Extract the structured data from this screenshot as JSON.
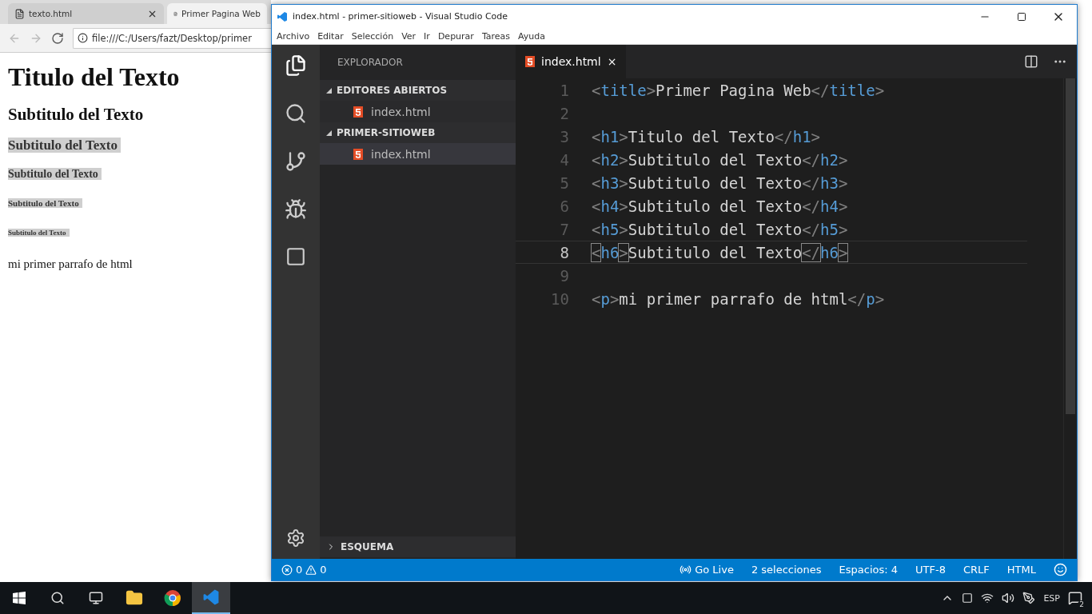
{
  "browser": {
    "tabs": [
      {
        "title": "texto.html",
        "selected": false
      },
      {
        "title": "Primer Pagina Web",
        "selected": true
      }
    ],
    "address": "file:///C:/Users/fazt/Desktop/primer",
    "headings": [
      {
        "kind": "h1",
        "text": "Titulo del Texto",
        "highlighted": false
      },
      {
        "kind": "h2",
        "text": "Subtitulo del Texto",
        "highlighted": false
      },
      {
        "kind": "h3",
        "text": "Subtitulo del Texto",
        "highlighted": true
      },
      {
        "kind": "h4",
        "text": "Subtitulo del Texto",
        "highlighted": true
      },
      {
        "kind": "h5",
        "text": "Subtitulo del Texto",
        "highlighted": true
      },
      {
        "kind": "h6",
        "text": "Subtitulo del Texto",
        "highlighted": true
      }
    ],
    "paragraph": "mi primer parrafo de html"
  },
  "vscode": {
    "title": "index.html - primer-sitioweb - Visual Studio Code",
    "menu": [
      "Archivo",
      "Editar",
      "Selección",
      "Ver",
      "Ir",
      "Depurar",
      "Tareas",
      "Ayuda"
    ],
    "explorer_title": "EXPLORADOR",
    "sections": [
      {
        "title": "EDITORES ABIERTOS",
        "expanded": true,
        "files": [
          {
            "name": "index.html",
            "selected": false
          }
        ]
      },
      {
        "title": "PRIMER-SITIOWEB",
        "expanded": true,
        "files": [
          {
            "name": "index.html",
            "selected": true
          }
        ]
      }
    ],
    "outline": {
      "title": "ESQUEMA",
      "expanded": false
    },
    "tab": {
      "label": "index.html",
      "close": "×"
    },
    "lines": [
      {
        "number": "1",
        "current": false,
        "segments": [
          {
            "kind": "punct",
            "text": "<",
            "matched": false
          },
          {
            "kind": "tag",
            "text": "title",
            "matched": false
          },
          {
            "kind": "punct",
            "text": ">",
            "matched": false
          },
          {
            "kind": "text",
            "text": "Primer Pagina Web",
            "matched": false
          },
          {
            "kind": "punct",
            "text": "</",
            "matched": false
          },
          {
            "kind": "tag",
            "text": "title",
            "matched": false
          },
          {
            "kind": "punct",
            "text": ">",
            "matched": false
          }
        ]
      },
      {
        "number": "2",
        "current": false
      },
      {
        "number": "3",
        "current": false,
        "segments": [
          {
            "kind": "punct",
            "text": "<",
            "matched": false
          },
          {
            "kind": "tag",
            "text": "h1",
            "matched": false
          },
          {
            "kind": "punct",
            "text": ">",
            "matched": false
          },
          {
            "kind": "text",
            "text": "Titulo del Texto",
            "matched": false
          },
          {
            "kind": "punct",
            "text": "</",
            "matched": false
          },
          {
            "kind": "tag",
            "text": "h1",
            "matched": false
          },
          {
            "kind": "punct",
            "text": ">",
            "matched": false
          }
        ]
      },
      {
        "number": "4",
        "current": false,
        "segments": [
          {
            "kind": "punct",
            "text": "<",
            "matched": false
          },
          {
            "kind": "tag",
            "text": "h2",
            "matched": false
          },
          {
            "kind": "punct",
            "text": ">",
            "matched": false
          },
          {
            "kind": "text",
            "text": "Subtitulo del Texto",
            "matched": false
          },
          {
            "kind": "punct",
            "text": "</",
            "matched": false
          },
          {
            "kind": "tag",
            "text": "h2",
            "matched": false
          },
          {
            "kind": "punct",
            "text": ">",
            "matched": false
          }
        ]
      },
      {
        "number": "5",
        "current": false,
        "segments": [
          {
            "kind": "punct",
            "text": "<",
            "matched": false
          },
          {
            "kind": "tag",
            "text": "h3",
            "matched": false
          },
          {
            "kind": "punct",
            "text": ">",
            "matched": false
          },
          {
            "kind": "text",
            "text": "Subtitulo del Texto",
            "matched": false
          },
          {
            "kind": "punct",
            "text": "</",
            "matched": false
          },
          {
            "kind": "tag",
            "text": "h3",
            "matched": false
          },
          {
            "kind": "punct",
            "text": ">",
            "matched": false
          }
        ]
      },
      {
        "number": "6",
        "current": false,
        "segments": [
          {
            "kind": "punct",
            "text": "<",
            "matched": false
          },
          {
            "kind": "tag",
            "text": "h4",
            "matched": false
          },
          {
            "kind": "punct",
            "text": ">",
            "matched": false
          },
          {
            "kind": "text",
            "text": "Subtitulo del Texto",
            "matched": false
          },
          {
            "kind": "punct",
            "text": "</",
            "matched": false
          },
          {
            "kind": "tag",
            "text": "h4",
            "matched": false
          },
          {
            "kind": "punct",
            "text": ">",
            "matched": false
          }
        ]
      },
      {
        "number": "7",
        "current": false,
        "segments": [
          {
            "kind": "punct",
            "text": "<",
            "matched": false
          },
          {
            "kind": "tag",
            "text": "h5",
            "matched": false
          },
          {
            "kind": "punct",
            "text": ">",
            "matched": false
          },
          {
            "kind": "text",
            "text": "Subtitulo del Texto",
            "matched": false
          },
          {
            "kind": "punct",
            "text": "</",
            "matched": false
          },
          {
            "kind": "tag",
            "text": "h5",
            "matched": false
          },
          {
            "kind": "punct",
            "text": ">",
            "matched": false
          }
        ]
      },
      {
        "number": "8",
        "current": true,
        "segments": [
          {
            "kind": "punct",
            "text": "<",
            "matched": true
          },
          {
            "kind": "tag",
            "text": "h6",
            "matched": false
          },
          {
            "kind": "punct",
            "text": ">",
            "matched": true
          },
          {
            "kind": "text",
            "text": "Subtitulo del Texto",
            "matched": false
          },
          {
            "kind": "punct",
            "text": "</",
            "matched": true
          },
          {
            "kind": "tag",
            "text": "h6",
            "matched": false
          },
          {
            "kind": "punct",
            "text": ">",
            "matched": true
          }
        ]
      },
      {
        "number": "9",
        "current": false
      },
      {
        "number": "10",
        "current": false,
        "segments": [
          {
            "kind": "punct",
            "text": "<",
            "matched": false
          },
          {
            "kind": "tag",
            "text": "p",
            "matched": false
          },
          {
            "kind": "punct",
            "text": ">",
            "matched": false
          },
          {
            "kind": "text",
            "text": "mi primer parrafo de html",
            "matched": false
          },
          {
            "kind": "punct",
            "text": "</",
            "matched": false
          },
          {
            "kind": "tag",
            "text": "p",
            "matched": false
          },
          {
            "kind": "punct",
            "text": ">",
            "matched": false
          }
        ]
      }
    ],
    "status": {
      "errors": "0",
      "warnings": "0",
      "items": [
        {
          "kind": "live",
          "text": "Go Live"
        },
        {
          "kind": "plain",
          "text": "2 selecciones"
        },
        {
          "kind": "plain",
          "text": "Espacios: 4"
        },
        {
          "kind": "plain",
          "text": "UTF-8"
        },
        {
          "kind": "plain",
          "text": "CRLF"
        },
        {
          "kind": "plain",
          "text": "HTML"
        }
      ]
    }
  },
  "taskbar": {
    "language": "ESP",
    "notifications": "2"
  }
}
